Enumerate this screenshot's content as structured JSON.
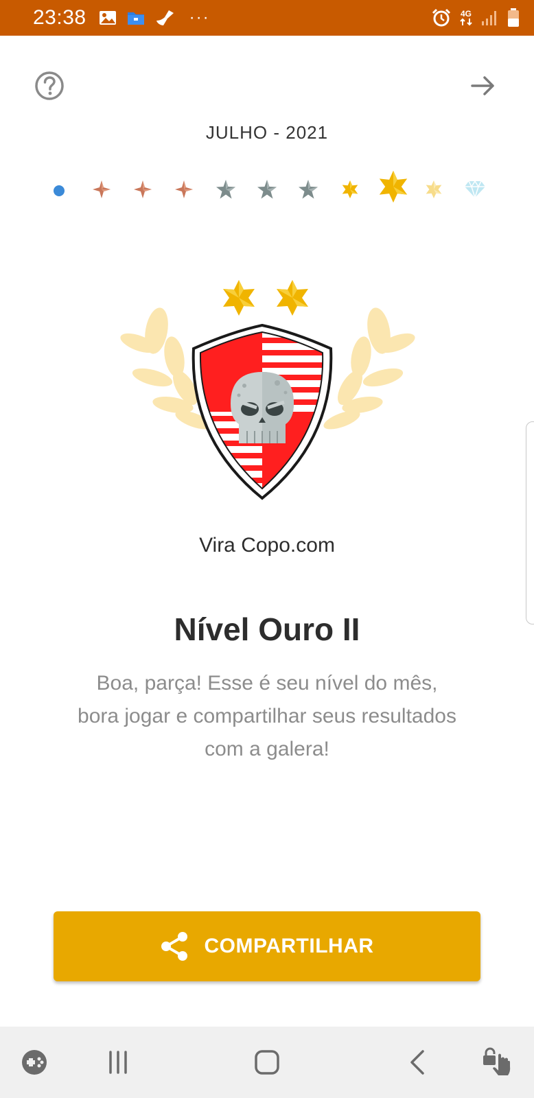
{
  "status_bar": {
    "time": "23:38",
    "network": "4G",
    "left_icons": [
      "gallery-icon",
      "folder-icon",
      "broom-icon"
    ],
    "more": "···",
    "right_icons": [
      "alarm-icon",
      "network-4g-icon",
      "signal-icon",
      "battery-icon"
    ]
  },
  "header": {
    "help_icon": "help-circle-icon",
    "next_icon": "arrow-right-icon",
    "month": "JULHO - 2021"
  },
  "levels": [
    {
      "icon": "dot-icon",
      "color": "#3b8ad8"
    },
    {
      "icon": "sparkle-icon",
      "color": "#c9775a"
    },
    {
      "icon": "sparkle-icon",
      "color": "#c9775a"
    },
    {
      "icon": "sparkle-icon",
      "color": "#c9775a"
    },
    {
      "icon": "star-icon",
      "color": "#7d8c8c"
    },
    {
      "icon": "star-icon",
      "color": "#7d8c8c"
    },
    {
      "icon": "star-icon",
      "color": "#7d8c8c"
    },
    {
      "icon": "gold-star-icon",
      "color": "#f0b400"
    },
    {
      "icon": "gold-star-icon",
      "color": "#f0b400",
      "current": true
    },
    {
      "icon": "gold-star-icon",
      "color": "#f7dc8a"
    },
    {
      "icon": "diamond-icon",
      "color": "#bfe7f2"
    }
  ],
  "badge": {
    "stars": 2,
    "shield_colors": [
      "#ff1f1f",
      "#ffffff"
    ],
    "laurel_color": "#fbe6b0",
    "emblem": "skull-icon"
  },
  "team_name": "Vira Copo.com",
  "level_title": "Nível Ouro II",
  "level_description": "Boa, parça! Esse é seu nível do mês, bora jogar e compartilhar seus resultados com a galera!",
  "share_button": {
    "label": "COMPARTILHAR",
    "icon": "share-icon",
    "color": "#e8a800"
  },
  "nav_bar": {
    "items": [
      "game-launcher-icon",
      "recent-apps-icon",
      "home-icon",
      "back-icon",
      "touch-lock-icon"
    ]
  }
}
